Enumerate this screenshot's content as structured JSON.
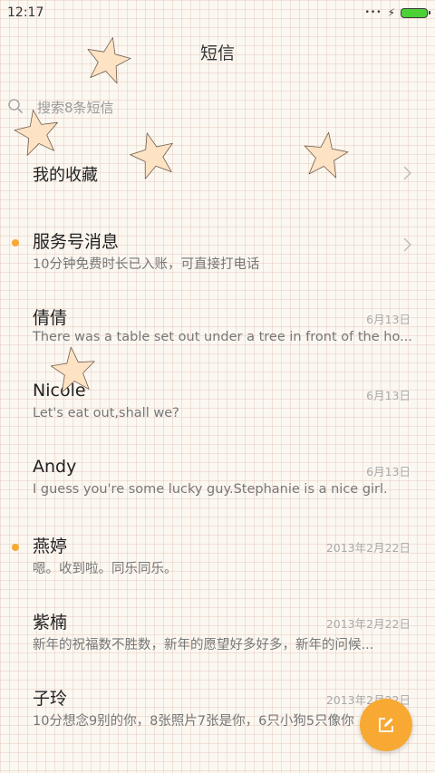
{
  "status": {
    "time": "12:17",
    "signal": "•••",
    "charging": "⚡"
  },
  "header": {
    "title": "短信"
  },
  "search": {
    "placeholder": "搜索8条短信"
  },
  "favorites": {
    "label": "我的收藏"
  },
  "colors": {
    "accent": "#f7a933",
    "unread_dot": "#f7a933",
    "battery": "#4cd137"
  },
  "conversations": [
    {
      "name": "服务号消息",
      "date": "",
      "preview": "10分钟免费时长已入账，可直接打电话",
      "unread": true
    },
    {
      "name": "倩倩",
      "date": "6月13日",
      "preview": "There was a table set out under a tree in front of the ho...",
      "unread": false
    },
    {
      "name": "Nicole",
      "date": "6月13日",
      "preview": "Let's eat out,shall we?",
      "unread": false
    },
    {
      "name": "Andy",
      "date": "6月13日",
      "preview": "I guess you're some lucky guy.Stephanie is a nice girl.",
      "unread": false
    },
    {
      "name": "燕婷",
      "date": "2013年2月22日",
      "preview": "嗯。收到啦。同乐同乐。",
      "unread": true
    },
    {
      "name": "紫楠",
      "date": "2013年2月22日",
      "preview": "新年的祝福数不胜数，新年的愿望好多好多，新年的问候...",
      "unread": false
    },
    {
      "name": "子玲",
      "date": "2013年2月22日",
      "preview": "10分想念9别的你，8张照片7张是你，6只小狗5只像你",
      "unread": false
    }
  ],
  "fab": {
    "icon": "compose-icon"
  }
}
